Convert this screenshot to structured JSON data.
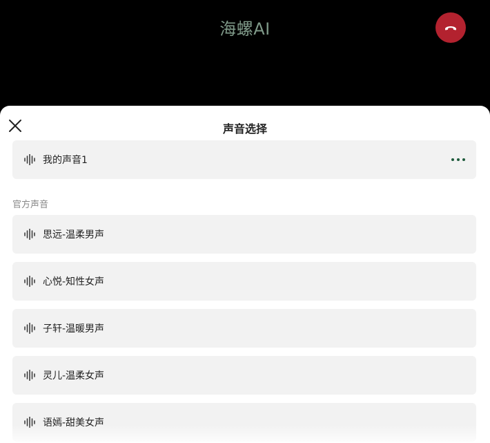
{
  "header": {
    "title": "海螺AI"
  },
  "sheet": {
    "title": "声音选择",
    "my_voices": [
      {
        "label": "我的声音1"
      }
    ],
    "official_section_label": "官方声音",
    "official_voices": [
      {
        "label": "思远-温柔男声"
      },
      {
        "label": "心悦-知性女声"
      },
      {
        "label": "子轩-温暖男声"
      },
      {
        "label": "灵儿-温柔女声"
      },
      {
        "label": "语嫣-甜美女声"
      }
    ]
  },
  "colors": {
    "hangup": "#b3222f",
    "title": "#7f9a89",
    "more_dots": "#1e5b3c"
  },
  "icons": {
    "close": "close-icon",
    "hangup": "phone-hangup-icon",
    "voice": "sound-wave-icon",
    "more": "more-icon"
  }
}
